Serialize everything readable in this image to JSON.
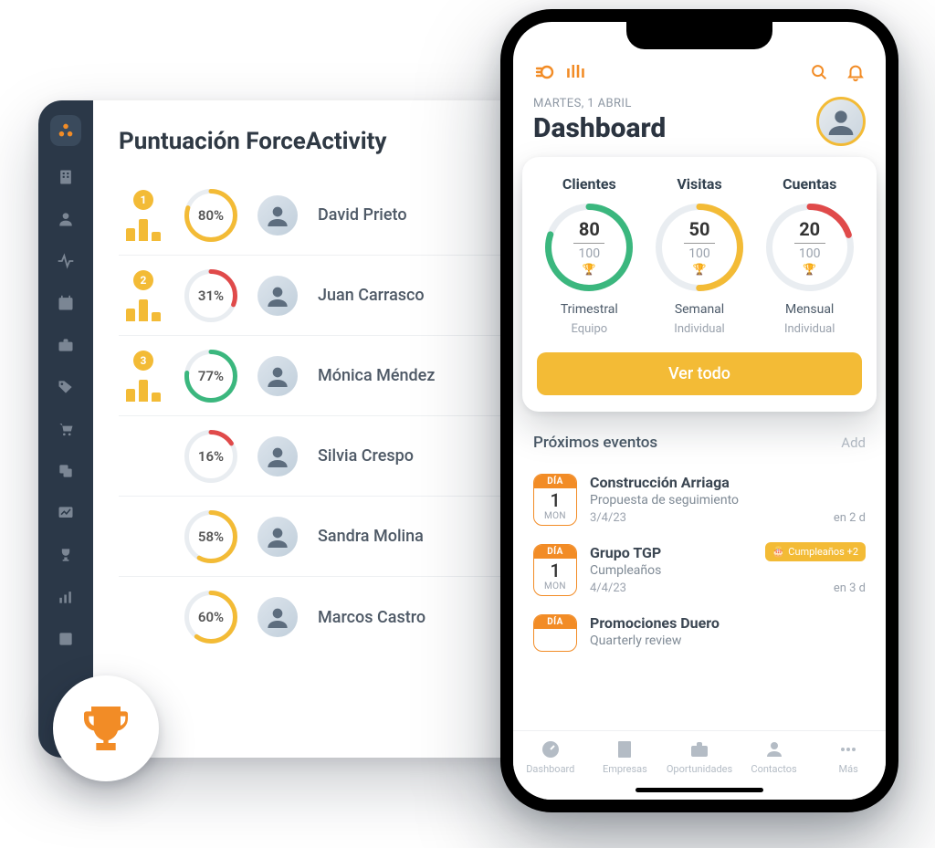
{
  "colors": {
    "ring_green": "#3bb77e",
    "ring_yellow": "#f3bb36",
    "ring_red": "#e04a4a"
  },
  "panel": {
    "title": "Puntuación ForceActivity",
    "rows": [
      {
        "rank": 1,
        "percent": 80,
        "ring_color": "#f3bb36",
        "name": "David Prieto"
      },
      {
        "rank": 2,
        "percent": 31,
        "ring_color": "#e04a4a",
        "name": "Juan Carrasco"
      },
      {
        "rank": 3,
        "percent": 77,
        "ring_color": "#3bb77e",
        "name": "Mónica Méndez"
      },
      {
        "rank": null,
        "percent": 16,
        "ring_color": "#e04a4a",
        "name": "Silvia Crespo"
      },
      {
        "rank": null,
        "percent": 58,
        "ring_color": "#f3bb36",
        "name": "Sandra Molina"
      },
      {
        "rank": null,
        "percent": 60,
        "ring_color": "#f3bb36",
        "name": "Marcos Castro"
      }
    ]
  },
  "phone": {
    "date_line": "MARTES, 1 ABRIL",
    "title": "Dashboard",
    "kpis": [
      {
        "label": "Clientes",
        "value": 80,
        "total": 100,
        "color": "#3bb77e",
        "period": "Trimestral",
        "scope": "Equipo"
      },
      {
        "label": "Visitas",
        "value": 50,
        "total": 100,
        "color": "#f3bb36",
        "period": "Semanal",
        "scope": "Individual"
      },
      {
        "label": "Cuentas",
        "value": 20,
        "total": 100,
        "color": "#e04a4a",
        "period": "Mensual",
        "scope": "Individual"
      }
    ],
    "ver_todo": "Ver todo",
    "events_title": "Próximos eventos",
    "events_add": "Add",
    "events": [
      {
        "dia": "DÍA",
        "day_num": "1",
        "dow": "MON",
        "title": "Construcción Arriaga",
        "sub": "Propuesta de seguimiento",
        "date": "3/4/23",
        "relative": "en 2 d",
        "birthday": null
      },
      {
        "dia": "DÍA",
        "day_num": "1",
        "dow": "MON",
        "title": "Grupo TGP",
        "sub": "Cumpleaños",
        "date": "4/4/23",
        "relative": "en 3 d",
        "birthday": "Cumpleaños +2"
      },
      {
        "dia": "DÍA",
        "day_num": "",
        "dow": "",
        "title": "Promociones Duero",
        "sub": "Quarterly review",
        "date": "",
        "relative": "",
        "birthday": null
      }
    ],
    "tabs": [
      {
        "label": "Dashboard"
      },
      {
        "label": "Empresas"
      },
      {
        "label": "Oportunidades"
      },
      {
        "label": "Contactos"
      },
      {
        "label": "Más"
      }
    ]
  }
}
